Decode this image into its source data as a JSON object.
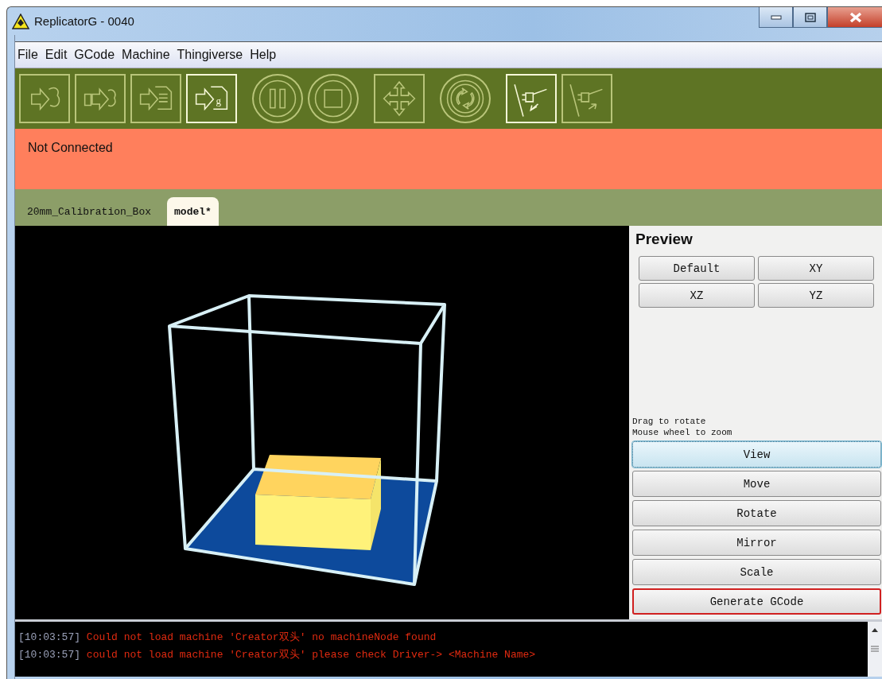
{
  "window": {
    "title": "ReplicatorG - 0040"
  },
  "menu": [
    "File",
    "Edit",
    "GCode",
    "Machine",
    "Thingiverse",
    "Help"
  ],
  "toolbar": [
    {
      "kind": "square",
      "disabled": true
    },
    {
      "kind": "square",
      "disabled": true
    },
    {
      "kind": "square",
      "disabled": true
    },
    {
      "kind": "square",
      "disabled": false,
      "glyph": "g"
    },
    {
      "kind": "circle",
      "disabled": true
    },
    {
      "kind": "circle",
      "disabled": true
    },
    {
      "kind": "square",
      "disabled": true
    },
    {
      "kind": "circle",
      "disabled": true
    },
    {
      "kind": "square",
      "disabled": false
    },
    {
      "kind": "square",
      "disabled": true
    }
  ],
  "status": "Not Connected",
  "tabs": [
    {
      "label": "20mm_Calibration_Box",
      "selected": false
    },
    {
      "label": "model*",
      "selected": true
    }
  ],
  "preview": {
    "title": "Preview",
    "view_buttons": [
      "Default",
      "XY",
      "XZ",
      "YZ"
    ],
    "hints": [
      "Drag to rotate",
      "Mouse wheel to zoom"
    ],
    "mode_buttons": [
      {
        "label": "View",
        "selected": true,
        "highlighted": false
      },
      {
        "label": "Move",
        "selected": false,
        "highlighted": false
      },
      {
        "label": "Rotate",
        "selected": false,
        "highlighted": false
      },
      {
        "label": "Mirror",
        "selected": false,
        "highlighted": false
      },
      {
        "label": "Scale",
        "selected": false,
        "highlighted": false
      },
      {
        "label": "Generate GCode",
        "selected": false,
        "highlighted": true
      }
    ]
  },
  "console": [
    {
      "time": "[10:03:57]",
      "message": "Could not load machine 'Creator双头' no machineNode found"
    },
    {
      "time": "[10:03:57]",
      "message": "could not load machine 'Creator双头' please check Driver-> <Machine Name>"
    }
  ]
}
